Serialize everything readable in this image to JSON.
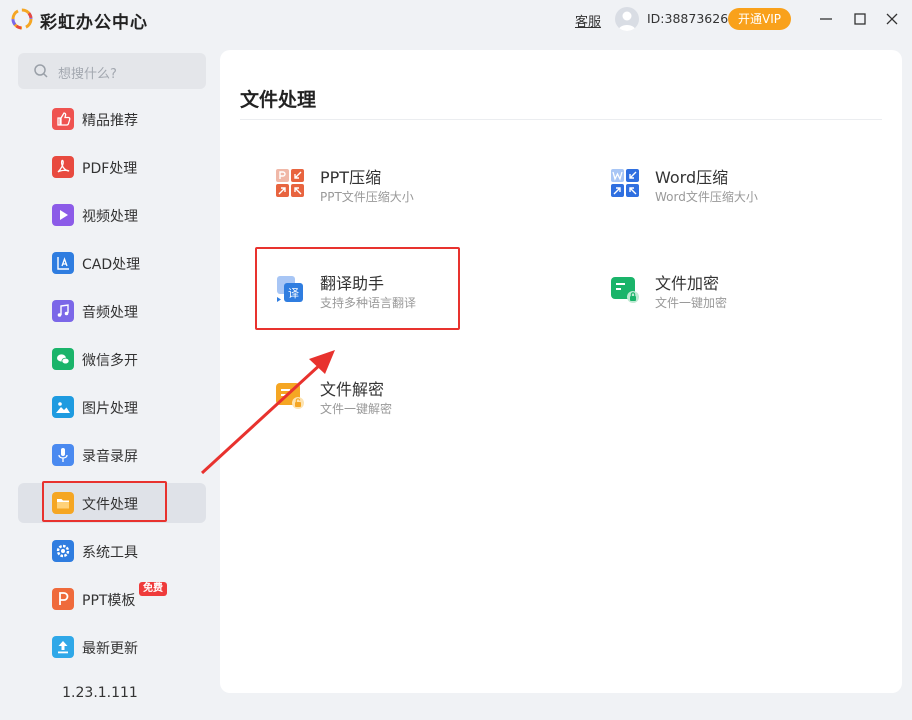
{
  "app": {
    "title": "彩虹办公中心",
    "service_label": "客服",
    "user_id": "ID:38873626",
    "vip_label": "开通VIP"
  },
  "search": {
    "placeholder": "想搜什么?"
  },
  "sidebar": {
    "items": [
      {
        "label": "精品推荐",
        "icon": "thumbs-up-icon",
        "color": "#ef5350"
      },
      {
        "label": "PDF处理",
        "icon": "pdf-icon",
        "color": "#e84a3f"
      },
      {
        "label": "视频处理",
        "icon": "video-play-icon",
        "color": "#8c5be8"
      },
      {
        "label": "CAD处理",
        "icon": "cad-icon",
        "color": "#2f7de0"
      },
      {
        "label": "音频处理",
        "icon": "music-icon",
        "color": "#7b67e8"
      },
      {
        "label": "微信多开",
        "icon": "wechat-icon",
        "color": "#1ab46a"
      },
      {
        "label": "图片处理",
        "icon": "image-icon",
        "color": "#1e9be0"
      },
      {
        "label": "录音录屏",
        "icon": "microphone-icon",
        "color": "#4a8af0"
      },
      {
        "label": "文件处理",
        "icon": "folder-icon",
        "color": "#f5a623",
        "active": true
      },
      {
        "label": "系统工具",
        "icon": "gear-icon",
        "color": "#2f7de0"
      },
      {
        "label": "PPT模板",
        "icon": "ppt-icon",
        "color": "#ef6a3b",
        "badge": "免费"
      },
      {
        "label": "最新更新",
        "icon": "upload-icon",
        "color": "#2fa8e8"
      }
    ],
    "version": "1.23.1.111"
  },
  "main": {
    "title": "文件处理",
    "tools": [
      {
        "name": "PPT压缩",
        "desc": "PPT文件压缩大小",
        "icon": "ppt-compress-icon"
      },
      {
        "name": "Word压缩",
        "desc": "Word文件压缩大小",
        "icon": "word-compress-icon"
      },
      {
        "name": "翻译助手",
        "desc": "支持多种语言翻译",
        "icon": "translate-icon"
      },
      {
        "name": "文件加密",
        "desc": "文件一键加密",
        "icon": "file-lock-icon"
      },
      {
        "name": "文件解密",
        "desc": "文件一键解密",
        "icon": "file-unlock-icon"
      }
    ]
  }
}
